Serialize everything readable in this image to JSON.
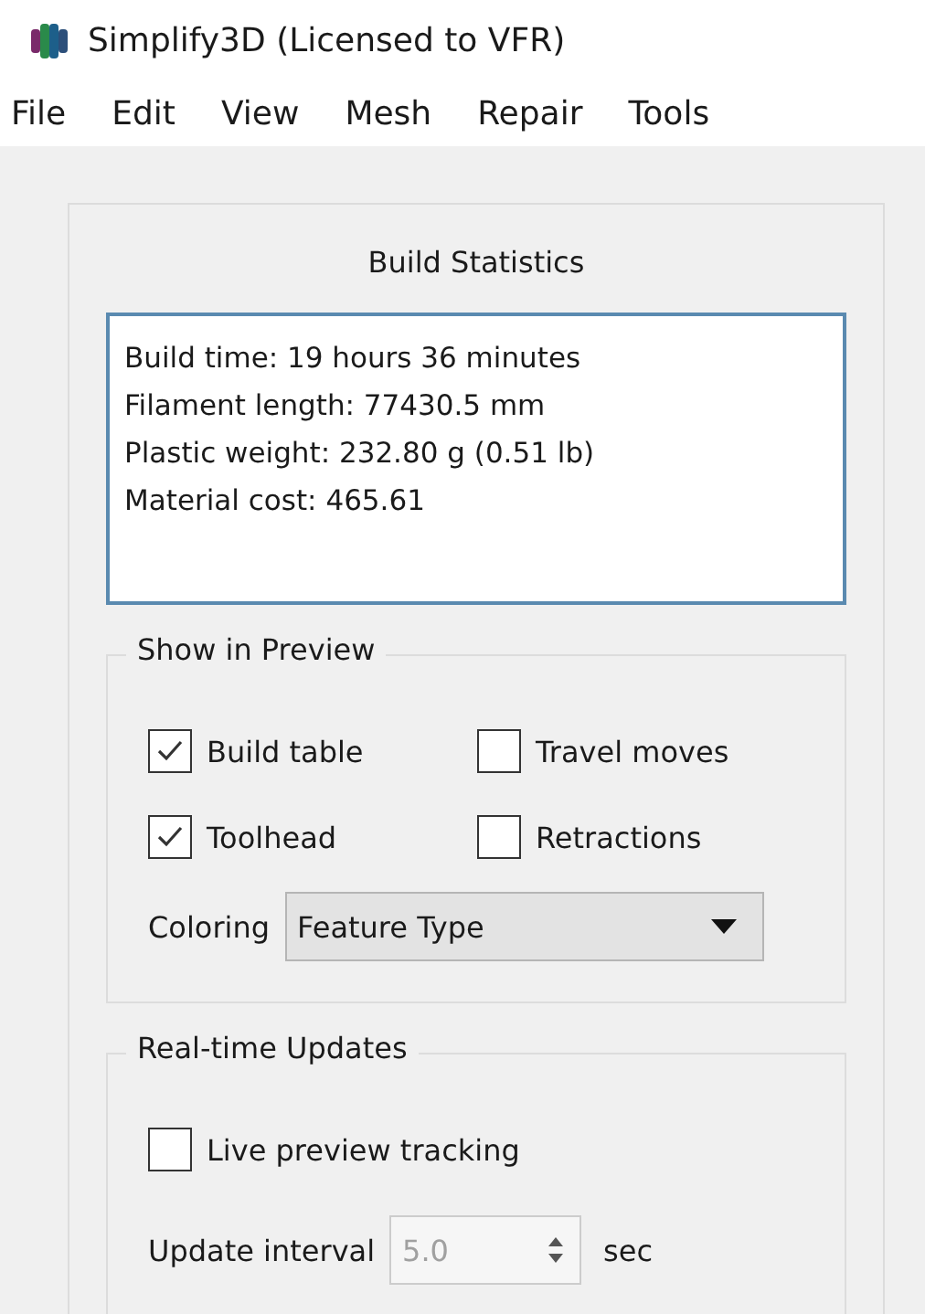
{
  "window": {
    "title": "Simplify3D (Licensed to VFR)"
  },
  "menu": [
    "File",
    "Edit",
    "View",
    "Mesh",
    "Repair",
    "Tools"
  ],
  "build_statistics": {
    "title": "Build Statistics",
    "lines": [
      "Build time: 19 hours 36 minutes",
      "Filament length: 77430.5 mm",
      "Plastic weight: 232.80 g (0.51 lb)",
      "Material cost: 465.61"
    ]
  },
  "show_in_preview": {
    "title": "Show in Preview",
    "checkboxes": [
      {
        "label": "Build table",
        "checked": true
      },
      {
        "label": "Travel moves",
        "checked": false
      },
      {
        "label": "Toolhead",
        "checked": true
      },
      {
        "label": "Retractions",
        "checked": false
      }
    ],
    "coloring": {
      "label": "Coloring",
      "value": "Feature Type"
    }
  },
  "realtime_updates": {
    "title": "Real-time Updates",
    "live_tracking": {
      "label": "Live preview tracking",
      "checked": false
    },
    "update_interval": {
      "label": "Update interval",
      "value": "5.0",
      "disabled": true,
      "unit": "sec"
    }
  }
}
